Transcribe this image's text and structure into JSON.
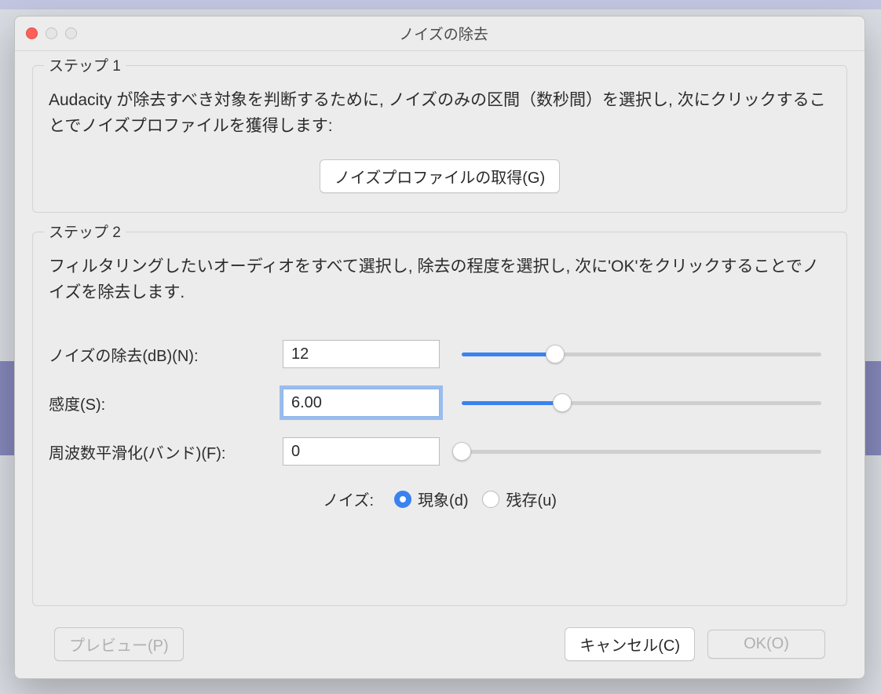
{
  "window": {
    "title": "ノイズの除去"
  },
  "step1": {
    "label": "ステップ 1",
    "instructions": "Audacity が除去すべき対象を判断するために, ノイズのみの区間（数秒間）を選択し, 次にクリックすることでノイズプロファイルを獲得します:",
    "getProfileButton": "ノイズプロファイルの取得(G)"
  },
  "step2": {
    "label": "ステップ 2",
    "instructions": "フィルタリングしたいオーディオをすべて選択し, 除去の程度を選択し, 次に'OK'をクリックすることでノイズを除去します.",
    "params": {
      "noiseReduction": {
        "label": "ノイズの除去(dB)(N):",
        "value": "12",
        "sliderPercent": 26
      },
      "sensitivity": {
        "label": "感度(S):",
        "value": "6.00",
        "sliderPercent": 28
      },
      "freqSmoothing": {
        "label": "周波数平滑化(バンド)(F):",
        "value": "0",
        "sliderPercent": 0
      }
    },
    "noiseMode": {
      "lead": "ノイズ:",
      "options": [
        {
          "label": "現象(d)",
          "selected": true
        },
        {
          "label": "残存(u)",
          "selected": false
        }
      ]
    }
  },
  "footer": {
    "preview": "プレビュー(P)",
    "cancel": "キャンセル(C)",
    "ok": "OK(O)"
  }
}
